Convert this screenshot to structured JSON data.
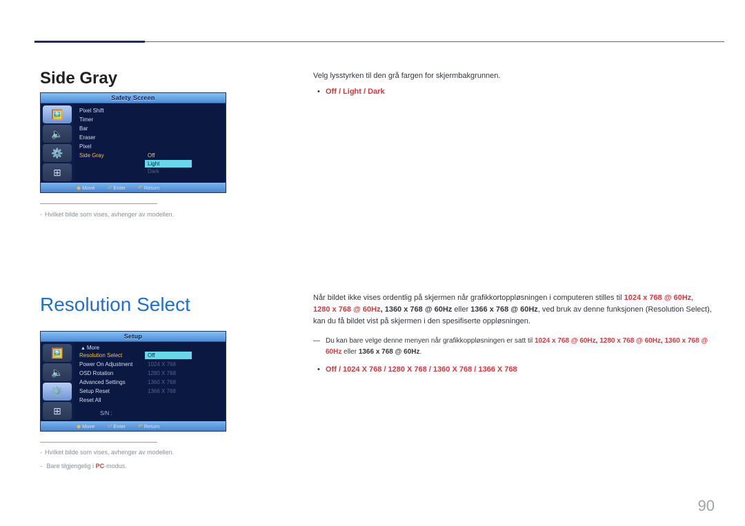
{
  "page_number": "90",
  "sections": {
    "side_gray": {
      "title": "Side Gray",
      "osd": {
        "title": "Safety Screen",
        "icons": [
          "picture-icon",
          "sound-icon",
          "setup-icon",
          "multi-icon"
        ],
        "items": [
          {
            "label": "Pixel Shift"
          },
          {
            "label": "Timer"
          },
          {
            "label": "Bar"
          },
          {
            "label": "Eraser"
          },
          {
            "label": "Pixel"
          },
          {
            "label": "Side Gray",
            "selected": true
          }
        ],
        "options_label": "Off",
        "options": [
          "Off",
          "Light",
          "Dark"
        ],
        "legend": {
          "move": "Move",
          "enter": "Enter",
          "return": "Return"
        }
      },
      "footnote": "Hvilket bilde som vises, avhenger av modellen.",
      "right_intro": "Velg lysstyrken til den grå fargen for skjermbakgrunnen.",
      "right_options": "Off / Light / Dark"
    },
    "resolution_select": {
      "title": "Resolution Select",
      "osd": {
        "title": "Setup",
        "icons": [
          "picture-icon",
          "sound-icon",
          "setup-icon",
          "multi-icon"
        ],
        "more": "More",
        "items": [
          {
            "label": "Resolution Select",
            "val": "Off",
            "selected": true
          },
          {
            "label": "Power On Adjustment",
            "val": "1024 X 768"
          },
          {
            "label": "OSD Rotation",
            "val": "1280 X 768"
          },
          {
            "label": "Advanced Settings",
            "val": "1360 X 768"
          },
          {
            "label": "Setup Reset",
            "val": "1366 X 768"
          },
          {
            "label": "Reset All"
          }
        ],
        "sn_label": "S/N :",
        "legend": {
          "move": "Move",
          "enter": "Enter",
          "return": "Return"
        }
      },
      "footnote1": "Hvilket bilde som vises, avhenger av modellen.",
      "footnote2_pre": "Bare tilgjengelig i ",
      "footnote2_red": "PC",
      "footnote2_post": "-modus.",
      "right": {
        "p1_a": "Når bildet ikke vises ordentlig på skjermen når grafikkortoppløsningen i computeren stilles til ",
        "p1_r1": "1024 x 768 @ 60Hz",
        "p1_s1": ", ",
        "p1_r2": "1280 x 768 @ 60Hz",
        "p1_s2": ", ",
        "p1_r3": "1360 x 768 @ 60Hz",
        "p1_m1": " eller ",
        "p1_r4": "1366 x 768 @ 60Hz",
        "p1_b": ", ved bruk av denne funksjonen (Resolution Select), kan du få bildet vist på skjermen i den spesifiserte oppløsningen.",
        "note_dash": "―",
        "note_a": "Du kan bare velge denne menyen når grafikkoppløsningen er satt til ",
        "note_r1": "1024 x 768 @ 60Hz",
        "note_s1": ", ",
        "note_r2": "1280 x 768 @ 60Hz",
        "note_s2": ", ",
        "note_r3": "1360 x 768 @ 60Hz",
        "note_m1": " eller ",
        "note_r4": "1366 x 768 @ 60Hz",
        "note_end": ".",
        "options": "Off / 1024 X 768 / 1280 X 768 / 1360 X 768 / 1366 X 768"
      }
    }
  }
}
